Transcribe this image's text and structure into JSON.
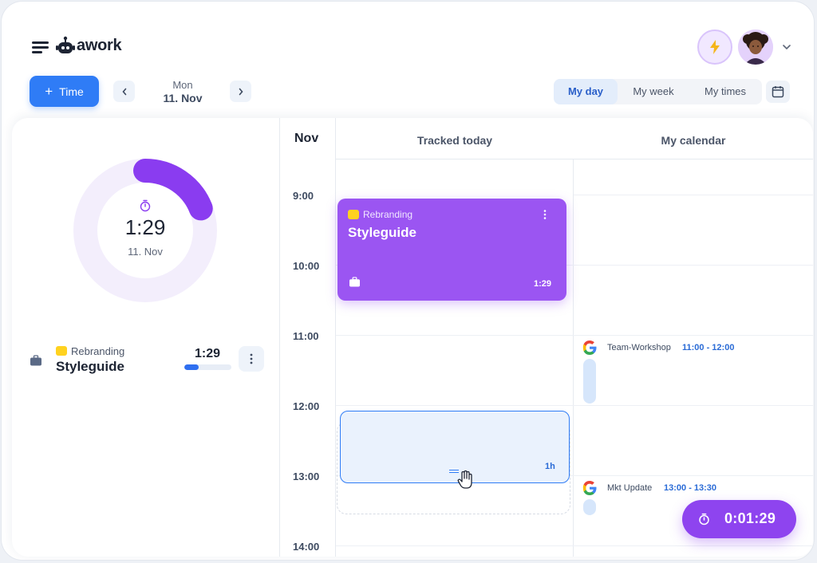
{
  "app": {
    "logo_text": "awork"
  },
  "header": {
    "bolt_icon": "bolt-icon",
    "avatar": "user-avatar"
  },
  "toolbar": {
    "time_button_label": "Time",
    "date_day": "Mon",
    "date_date": "11. Nov",
    "view_tabs": [
      {
        "label": "My day",
        "active": true
      },
      {
        "label": "My week",
        "active": false
      },
      {
        "label": "My times",
        "active": false
      }
    ]
  },
  "summary": {
    "total_time": "1:29",
    "date": "11. Nov",
    "ring_progress_fraction": 0.19
  },
  "entries": [
    {
      "project": "Rebranding",
      "task": "Styleguide",
      "duration": "1:29",
      "progress_fraction": 0.3
    }
  ],
  "calendar": {
    "month_label": "Nov",
    "hours": [
      "9:00",
      "10:00",
      "11:00",
      "12:00",
      "13:00",
      "14:00"
    ],
    "col_tracked": "Tracked today",
    "col_calendar": "My calendar",
    "tracked_card": {
      "project": "Rebranding",
      "task": "Styleguide",
      "duration": "1:29"
    },
    "draft_card": {
      "duration": "1h"
    },
    "events": [
      {
        "title": "Team-Workshop",
        "time": "11:00 - 12:00"
      },
      {
        "title": "Mkt Update",
        "time": "13:00 - 13:30"
      }
    ]
  },
  "timer": {
    "elapsed": "0:01:29"
  },
  "colors": {
    "accent_blue": "#2f7cf6",
    "accent_purple": "#9b55f2",
    "project_yellow": "#ffd21f"
  }
}
